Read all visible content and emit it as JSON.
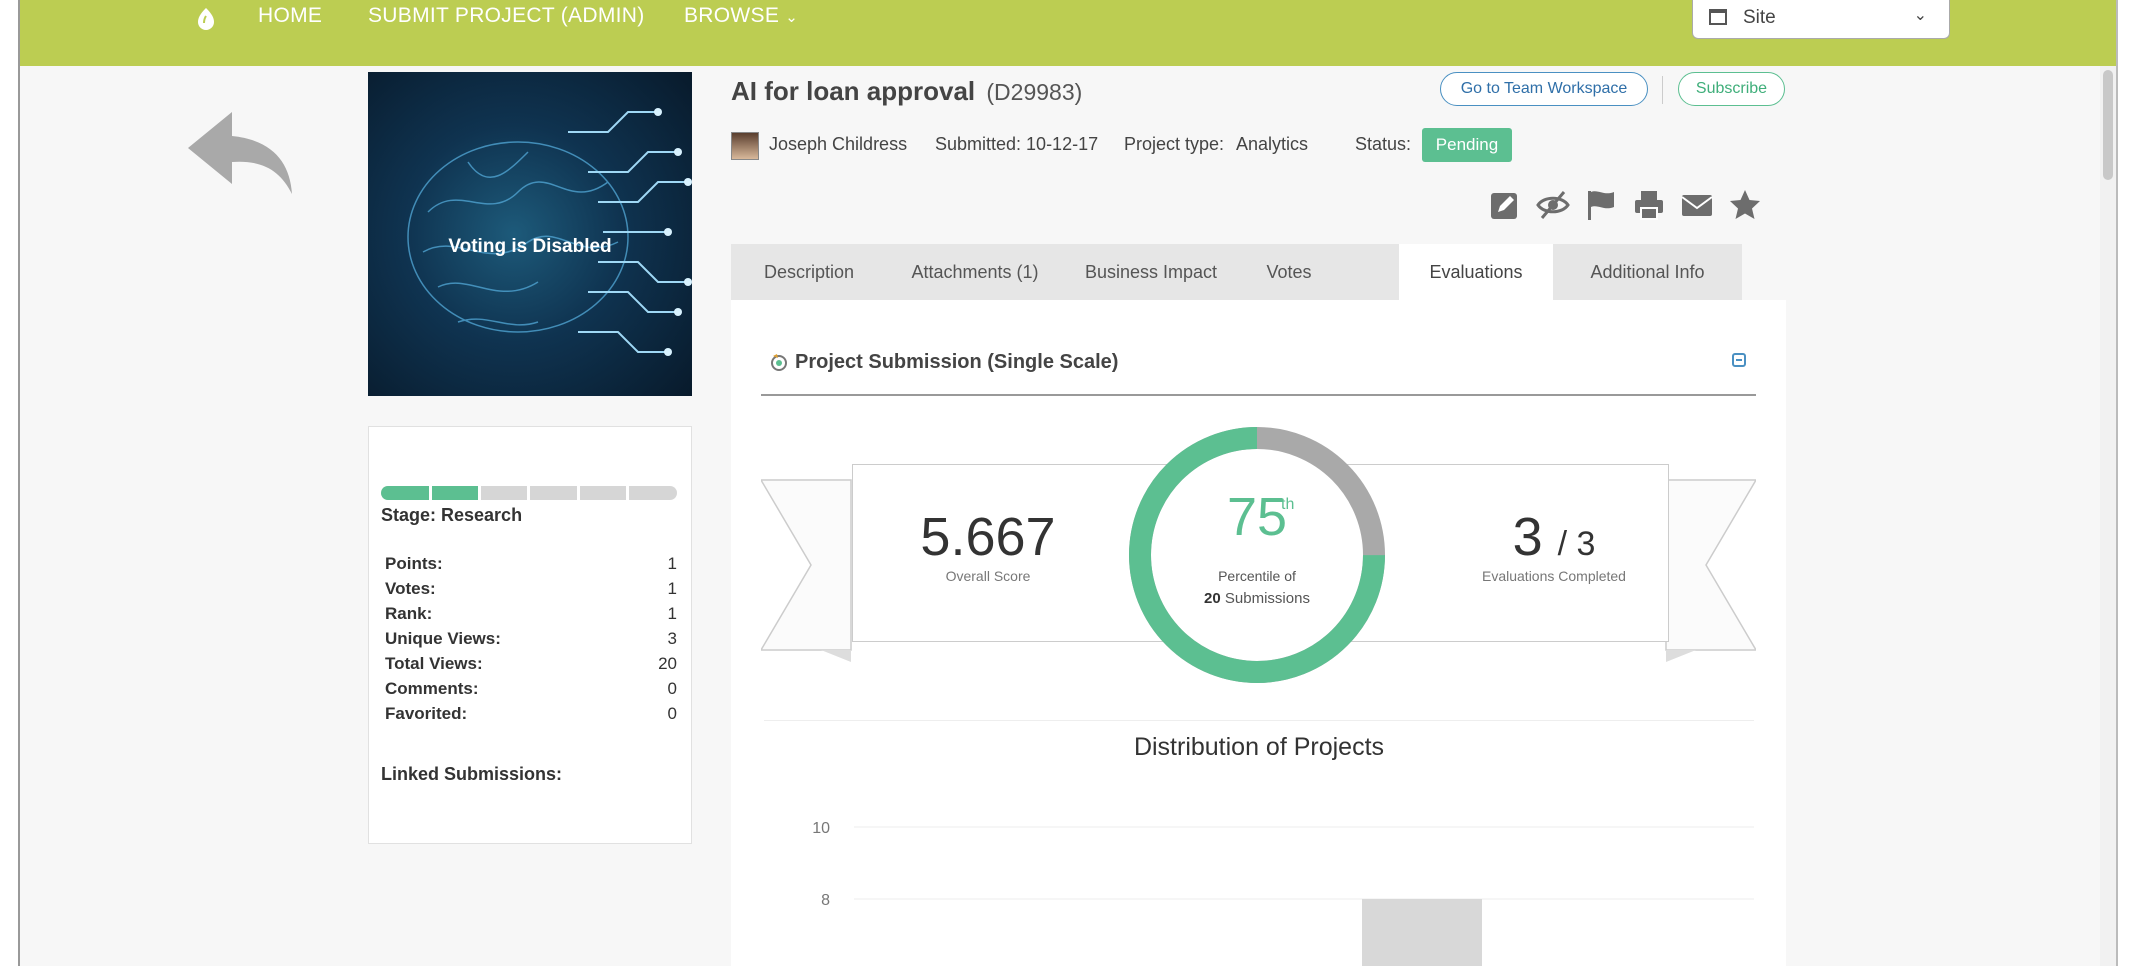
{
  "nav": {
    "home": "HOME",
    "submit": "SUBMIT PROJECT (ADMIN)",
    "browse": "BROWSE",
    "browse_chevron": "⌄"
  },
  "site_select": {
    "value": "Site",
    "chevron": "⌄"
  },
  "hero": {
    "overlay_text": "Voting is Disabled"
  },
  "stats": {
    "stage": "Stage: Research",
    "progress_fraction": 0.33,
    "rows": [
      {
        "label": "Points:",
        "value": "1"
      },
      {
        "label": "Votes:",
        "value": "1"
      },
      {
        "label": "Rank:",
        "value": "1"
      },
      {
        "label": "Unique Views:",
        "value": "3"
      },
      {
        "label": "Total Views:",
        "value": "20"
      },
      {
        "label": "Comments:",
        "value": "0"
      },
      {
        "label": "Favorited:",
        "value": "0"
      }
    ],
    "linked": "Linked Submissions:"
  },
  "project": {
    "title": "AI for loan approval",
    "id": "(D29983)",
    "author": "Joseph Childress",
    "submitted": "Submitted: 10-12-17",
    "type_label": "Project type:",
    "type_value": "Analytics",
    "status_label": "Status:",
    "status_value": "Pending"
  },
  "buttons": {
    "team_workspace": "Go to Team Workspace",
    "subscribe": "Subscribe"
  },
  "action_icons": [
    "edit-icon",
    "hide-icon",
    "flag-icon",
    "print-icon",
    "email-icon",
    "favorite-star-icon"
  ],
  "tabs": [
    {
      "label": "Description",
      "active": false
    },
    {
      "label": "Attachments (1)",
      "active": false
    },
    {
      "label": "Business Impact",
      "active": false
    },
    {
      "label": "Votes",
      "active": false
    },
    {
      "label": "Evaluations",
      "active": true
    },
    {
      "label": "Additional Info",
      "active": false
    }
  ],
  "evaluation": {
    "panel_title": "Project Submission (Single Scale)",
    "overall_score": "5.667",
    "overall_score_label": "Overall Score",
    "percentile": "75",
    "percentile_suffix": "th",
    "percentile_label": "Percentile of",
    "submissions_count": "20",
    "submissions_label": "Submissions",
    "percentile_fraction": 0.75,
    "evaluations_done": "3",
    "evaluations_total": "/ 3",
    "evaluations_label": "Evaluations Completed"
  },
  "chart_data": {
    "type": "bar",
    "title": "Distribution of Projects",
    "yticks": [
      10,
      8
    ],
    "ylim": [
      0,
      10
    ],
    "values": [
      8
    ],
    "colors": {
      "bar": "#d8d8d8",
      "grid": "#eeeeee"
    }
  },
  "colors": {
    "topbar": "#bccd52",
    "accent_green": "#5cbf91",
    "link_blue": "#2f6fa8",
    "donut_rest": "#a9a9a9"
  }
}
